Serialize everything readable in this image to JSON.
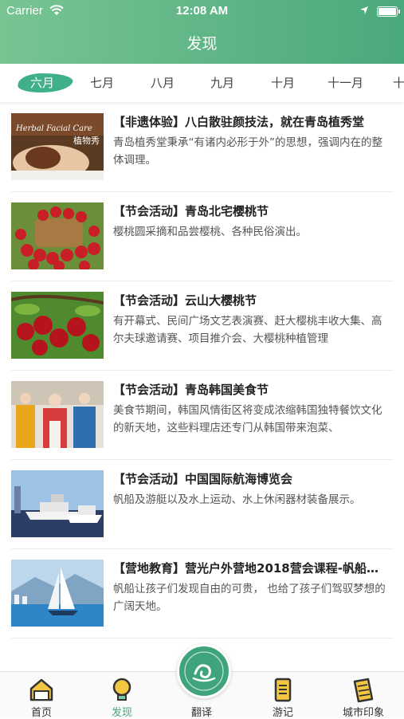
{
  "status_bar": {
    "carrier": "Carrier",
    "time": "12:08 AM"
  },
  "header": {
    "title": "发现"
  },
  "months": [
    "六月",
    "七月",
    "八月",
    "九月",
    "十月",
    "十一月",
    "十"
  ],
  "items": [
    {
      "title": "【非遗体验】八白散驻颜技法，就在青岛植秀堂",
      "desc": "青岛植秀堂秉承“有诸内必形于外”的思想，强调内在的整体调理。",
      "thumb_text": "Herbal Facial Care"
    },
    {
      "title": "【节会活动】青岛北宅樱桃节",
      "desc": "樱桃圆采摘和品尝樱桃、各种民俗演出。"
    },
    {
      "title": "【节会活动】云山大樱桃节",
      "desc": "有开幕式、民间广场文艺表演赛、赶大樱桃丰收大集、高尔夫球邀请赛、项目推介会、大樱桃种植管理"
    },
    {
      "title": "【节会活动】青岛韩国美食节",
      "desc": "美食节期间，韩国风情街区将变成浓缩韩国独特餐饮文化的新天地，这些料理店还专门从韩国带来泡菜、"
    },
    {
      "title": "【节会活动】中国国际航海博览会",
      "desc": "帆船及游艇以及水上运动、水上休闲器材装备展示。"
    },
    {
      "title": "【营地教育】营光户外营地2018营会课程-帆船…",
      "desc": "帆船让孩子们发现自由的可贵， 也给了孩子们驾驭梦想的广阔天地。"
    }
  ],
  "tabbar": {
    "home": "首页",
    "discover": "发现",
    "translate": "翻译",
    "notes": "游记",
    "city": "城市印象"
  },
  "colors": {
    "brand": "#4aa97b",
    "active_tab_bg": "#3fb08a"
  }
}
